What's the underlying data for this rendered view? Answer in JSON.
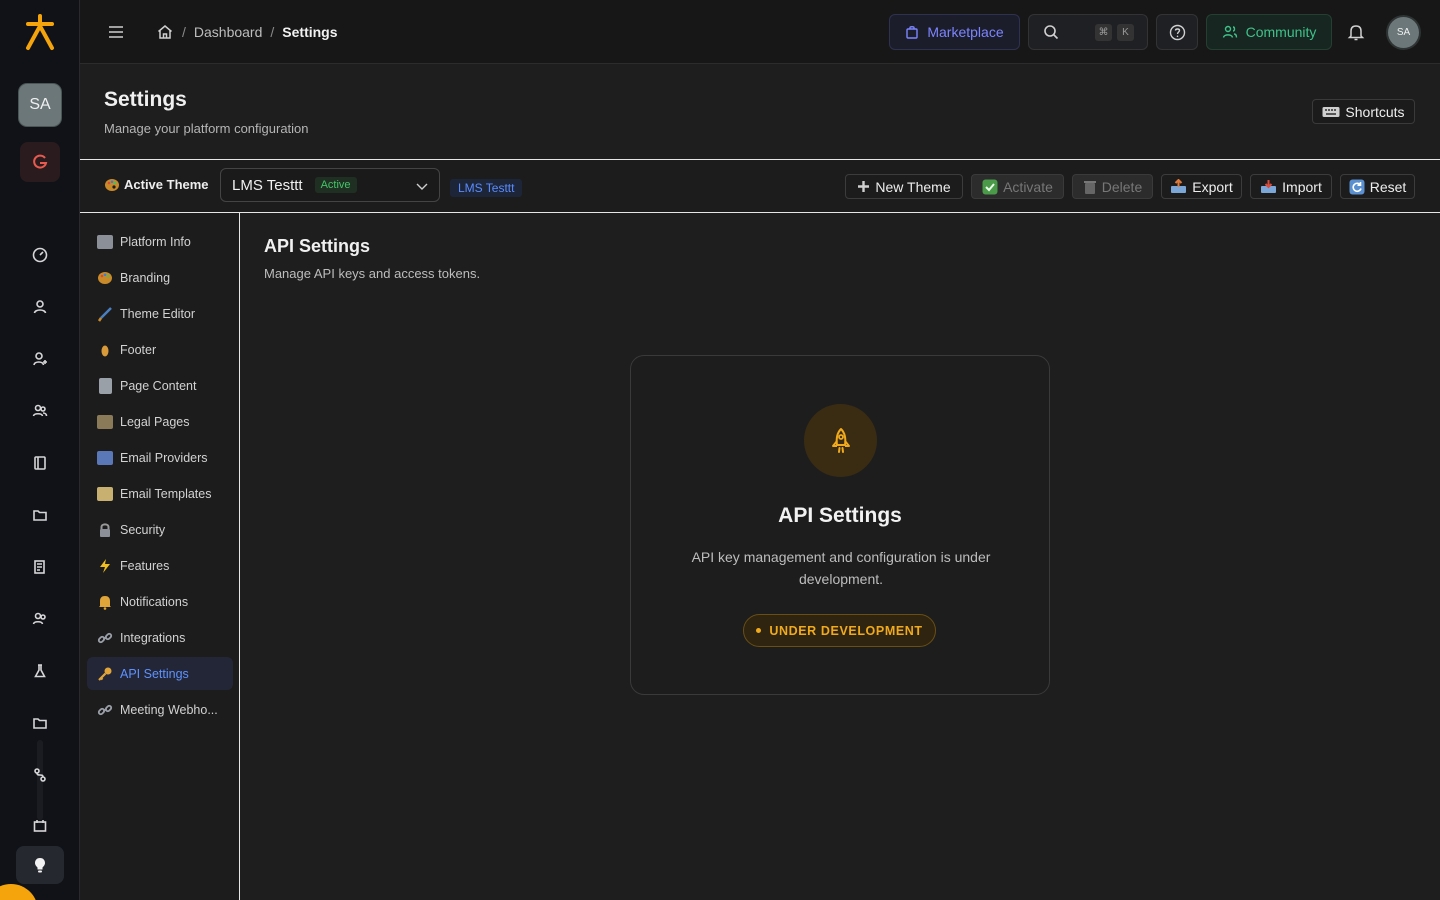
{
  "rail": {
    "avatar_initials": "SA",
    "icons": [
      "speedometer-icon",
      "user-icon",
      "user-plus-icon",
      "users-icon",
      "book-icon",
      "folder-icon",
      "report-icon",
      "team-icon",
      "flask-icon",
      "folder2-icon",
      "workflow-icon",
      "calendar-icon"
    ]
  },
  "topbar": {
    "breadcrumb": {
      "dashboard": "Dashboard",
      "current": "Settings",
      "separator": "/"
    },
    "marketplace_label": "Marketplace",
    "search_shortcut": [
      "⌘",
      "K"
    ],
    "community_label": "Community",
    "avatar_initials": "SA"
  },
  "header": {
    "title": "Settings",
    "subtitle": "Manage your platform configuration",
    "shortcuts_label": "Shortcuts"
  },
  "theme_bar": {
    "label": "Active Theme",
    "selected_theme": "LMS Testtt",
    "active_tag": "Active",
    "chip": "LMS Testtt",
    "new_theme": "New Theme",
    "activate": "Activate",
    "delete": "Delete",
    "export": "Export",
    "import": "Import",
    "reset": "Reset"
  },
  "settings_nav": {
    "items": [
      {
        "label": "Platform Info"
      },
      {
        "label": "Branding"
      },
      {
        "label": "Theme Editor"
      },
      {
        "label": "Footer"
      },
      {
        "label": "Page Content"
      },
      {
        "label": "Legal Pages"
      },
      {
        "label": "Email Providers"
      },
      {
        "label": "Email Templates"
      },
      {
        "label": "Security"
      },
      {
        "label": "Features"
      },
      {
        "label": "Notifications"
      },
      {
        "label": "Integrations"
      },
      {
        "label": "API Settings"
      },
      {
        "label": "Meeting Webho..."
      }
    ],
    "active": "API Settings"
  },
  "main": {
    "title": "API Settings",
    "subtitle": "Manage API keys and access tokens.",
    "card": {
      "title": "API Settings",
      "text": "API key management and configuration is under development.",
      "badge": "UNDER DEVELOPMENT"
    }
  },
  "colors": {
    "accent_blue": "#5d92ff",
    "marketplace": "#7c85ff",
    "community": "#3ec28a",
    "warning": "#f0aa1c",
    "brand_orange": "#f5a50b"
  }
}
